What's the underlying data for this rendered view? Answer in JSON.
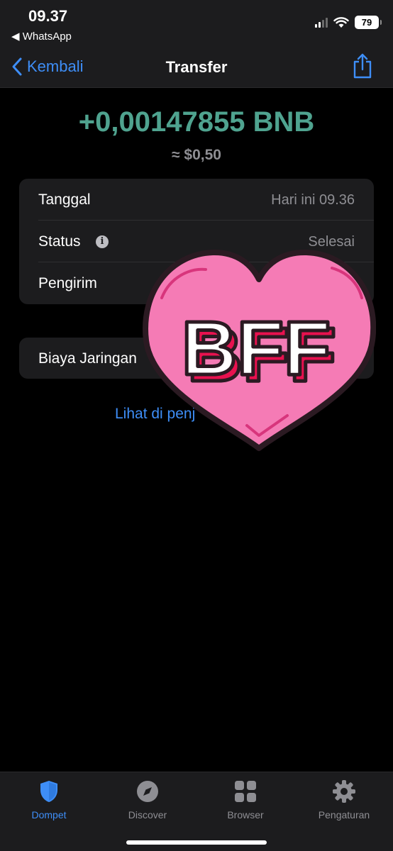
{
  "status_bar": {
    "time": "09.37",
    "back_app": "◀ WhatsApp",
    "battery": "79"
  },
  "nav": {
    "back_label": "Kembali",
    "title": "Transfer",
    "share_icon": "share-icon"
  },
  "transaction": {
    "amount": "+0,00147855 BNB",
    "fiat": "≈ $0,50"
  },
  "details": [
    {
      "label": "Tanggal",
      "value": "Hari ini 09.36"
    },
    {
      "label": "Status",
      "value": "Selesai"
    },
    {
      "label": "Pengirim",
      "value": ""
    }
  ],
  "fee": {
    "label": "Biaya Jaringan"
  },
  "explorer_link": "Lihat di penj",
  "sticker": {
    "text": "BFF"
  },
  "tabs": [
    {
      "label": "Dompet",
      "icon": "shield-icon",
      "active": true
    },
    {
      "label": "Discover",
      "icon": "compass-icon",
      "active": false
    },
    {
      "label": "Browser",
      "icon": "grid-icon",
      "active": false
    },
    {
      "label": "Pengaturan",
      "icon": "gear-icon",
      "active": false
    }
  ],
  "colors": {
    "accent": "#3e8ef7",
    "amount_green": "#4fa38f",
    "sticker_pink": "#f57bb5"
  }
}
